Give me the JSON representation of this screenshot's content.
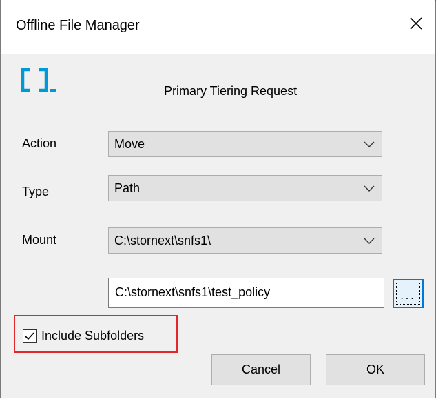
{
  "window": {
    "title": "Offline File Manager",
    "close_icon": "close-icon"
  },
  "header": {
    "logo": "bracket-logo",
    "logo_color": "#0099d8",
    "heading": "Primary Tiering Request"
  },
  "form": {
    "action": {
      "label": "Action",
      "value": "Move"
    },
    "type": {
      "label": "Type",
      "value": "Path"
    },
    "mount": {
      "label": "Mount",
      "value": "C:\\stornext\\snfs1\\"
    },
    "path": {
      "value": "C:\\stornext\\snfs1\\test_policy"
    },
    "browse_label": "...",
    "include_subfolders": {
      "label": "Include Subfolders",
      "checked": true
    }
  },
  "buttons": {
    "cancel": "Cancel",
    "ok": "OK"
  },
  "colors": {
    "highlight": "#e32629",
    "focus": "#0078d7"
  }
}
